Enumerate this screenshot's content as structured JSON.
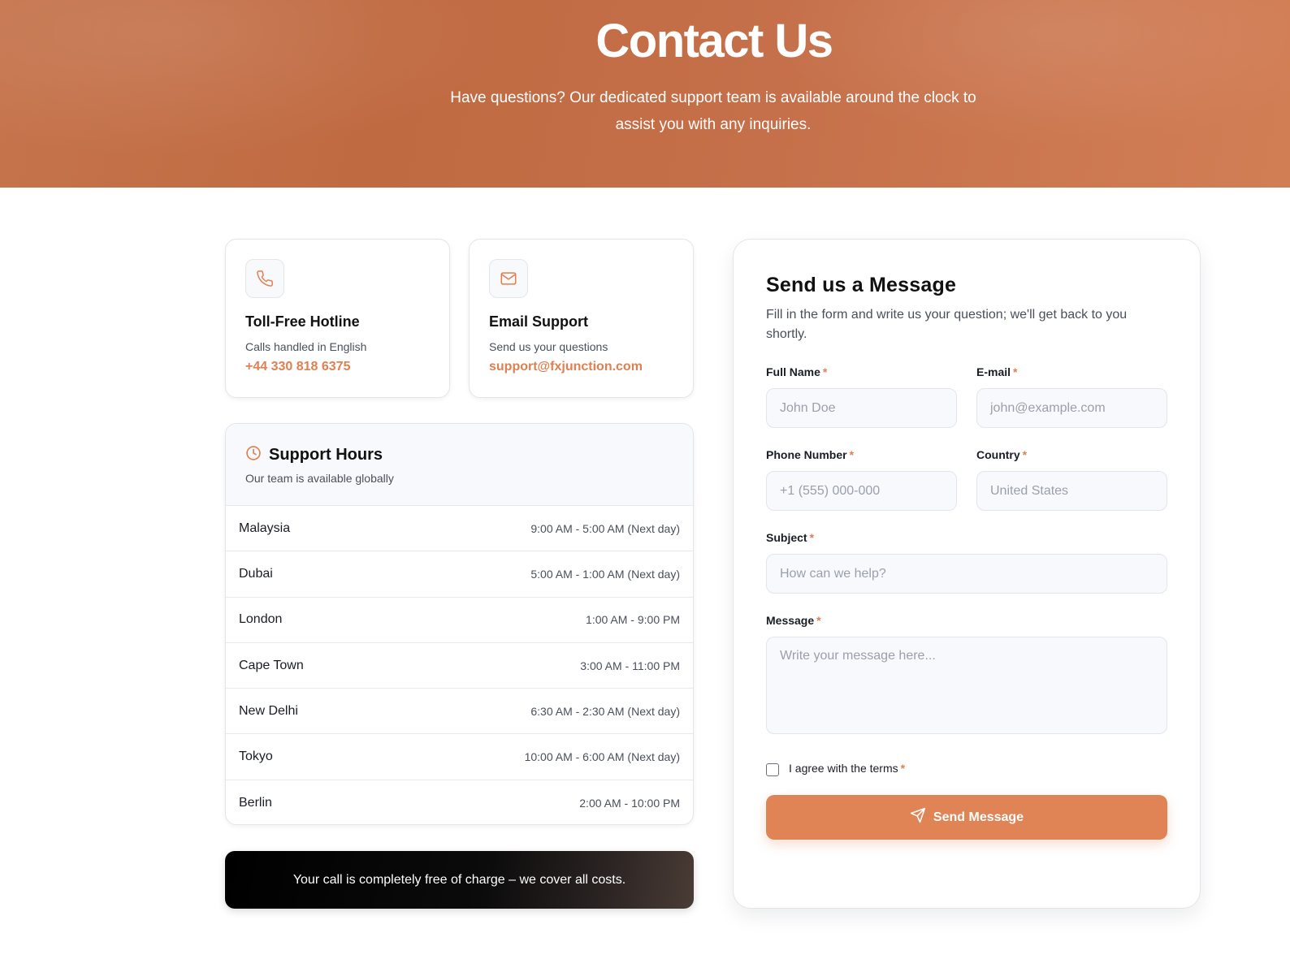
{
  "hero": {
    "title": "Contact Us",
    "subtitle": "Have questions? Our dedicated support team is available around the clock to assist you with any inquiries."
  },
  "contact_cards": [
    {
      "icon": "phone-icon",
      "title": "Toll-Free Hotline",
      "sub": "Calls handled in English",
      "value": "+44 330 818 6375"
    },
    {
      "icon": "mail-icon",
      "title": "Email Support",
      "sub": "Send us your questions",
      "value": "support@fxjunction.com"
    }
  ],
  "support_hours": {
    "title": "Support Hours",
    "subtitle": "Our team is available globally",
    "rows": [
      {
        "city": "Malaysia",
        "time": "9:00 AM - 5:00 AM (Next day)"
      },
      {
        "city": "Dubai",
        "time": "5:00 AM - 1:00 AM (Next day)"
      },
      {
        "city": "London",
        "time": "1:00 AM - 9:00 PM"
      },
      {
        "city": "Cape Town",
        "time": "3:00 AM - 11:00 PM"
      },
      {
        "city": "New Delhi",
        "time": "6:30 AM - 2:30 AM (Next day)"
      },
      {
        "city": "Tokyo",
        "time": "10:00 AM - 6:00 AM (Next day)"
      },
      {
        "city": "Berlin",
        "time": "2:00 AM - 10:00 PM"
      }
    ]
  },
  "banner": {
    "text": "Your call is completely free of charge – we cover all costs."
  },
  "form": {
    "title": "Send us a Message",
    "intro": "Fill in the form and write us your question; we'll get back to you shortly.",
    "required_mark": "*",
    "full_name": {
      "label": "Full Name",
      "placeholder": "John Doe"
    },
    "email": {
      "label": "E-mail",
      "placeholder": "john@example.com"
    },
    "phone": {
      "label": "Phone Number",
      "placeholder": "+1 (555) 000-000"
    },
    "country": {
      "label": "Country",
      "value": "United States"
    },
    "subject": {
      "label": "Subject",
      "placeholder": "How can we help?"
    },
    "message": {
      "label": "Message",
      "placeholder": "Write your message here..."
    },
    "terms_label": "I agree with the terms",
    "submit_label": "Send Message"
  },
  "colors": {
    "accent": "#e08456",
    "hero": "#c46d44"
  }
}
